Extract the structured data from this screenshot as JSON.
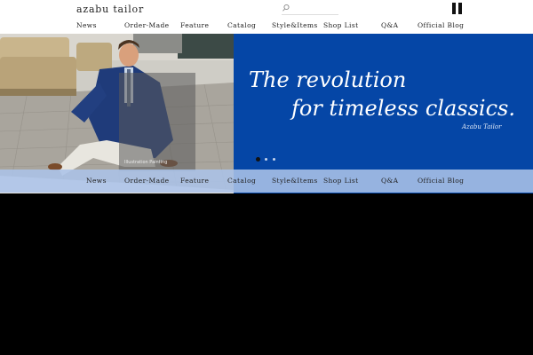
{
  "header": {
    "logo": "azabu tailor",
    "search_placeholder": ""
  },
  "nav": {
    "items": [
      "News",
      "Order-Made",
      "Feature",
      "Catalog",
      "Style&Items",
      "Shop List",
      "Q&A",
      "Official Blog"
    ]
  },
  "hero": {
    "tagline_line1": "The revolution",
    "tagline_line2": "for timeless classics.",
    "signature": "Azabu Tailor",
    "caption": "Illustration Painting",
    "slides": 3,
    "active_slide": 1
  },
  "colors": {
    "brand_blue": "#0546a6",
    "nav_overlay": "#abc3e8",
    "topbar": "#ffffff",
    "page_bg": "#000000"
  },
  "icons": [
    "search-icon",
    "pause-icon"
  ]
}
